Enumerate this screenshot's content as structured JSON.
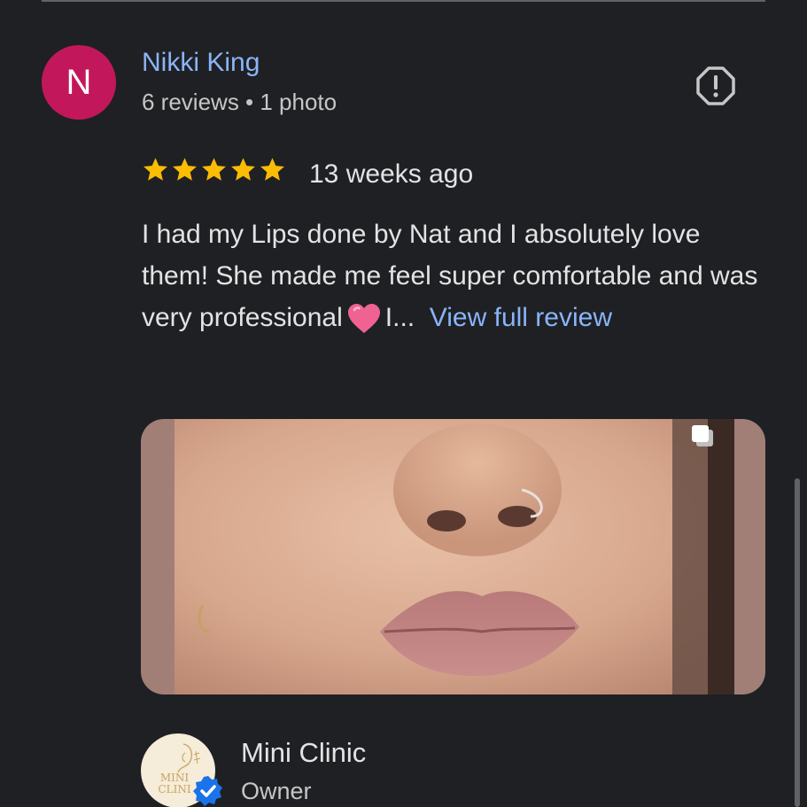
{
  "review": {
    "avatar_letter": "N",
    "avatar_color": "#c2185b",
    "reviewer_name": "Nikki King",
    "reviewer_meta": "6 reviews • 1 photo",
    "rating": 5,
    "rating_max": 5,
    "star_color": "#fbbc04",
    "time_ago": "13 weeks ago",
    "text_part1": "I had my Lips done by Nat and I absolutely love them! She made me feel super comfortable and was very professional",
    "emoji": "pink-heart",
    "text_part2": "I...",
    "view_full_label": "View full review",
    "report_icon": "report-flag-icon",
    "photo_icon": "multiple-photos-icon"
  },
  "owner_reply": {
    "name": "Mini Clinic",
    "role": "Owner",
    "logo_text_line1": "MINI",
    "logo_text_line2": "CLINI",
    "verified_color": "#1a73e8"
  },
  "colors": {
    "background": "#1f2024",
    "link": "#8ab4f8",
    "text": "#e3e3e3",
    "muted": "#c4c7c5"
  }
}
